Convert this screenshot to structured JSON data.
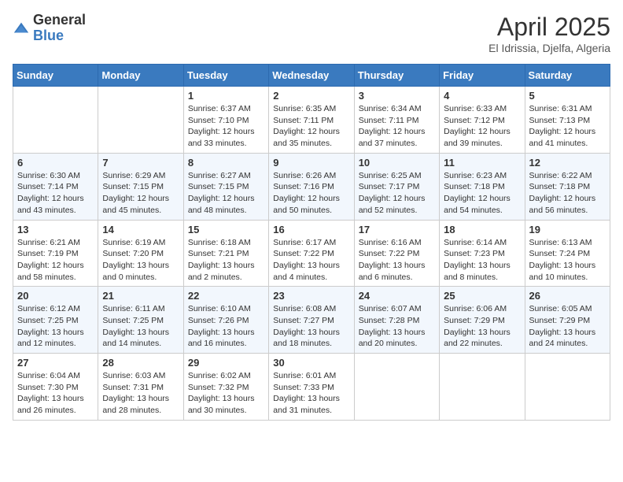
{
  "header": {
    "logo_general": "General",
    "logo_blue": "Blue",
    "title": "April 2025",
    "subtitle": "El Idrissia, Djelfa, Algeria"
  },
  "days_of_week": [
    "Sunday",
    "Monday",
    "Tuesday",
    "Wednesday",
    "Thursday",
    "Friday",
    "Saturday"
  ],
  "weeks": [
    [
      {
        "day": "",
        "info": ""
      },
      {
        "day": "",
        "info": ""
      },
      {
        "day": "1",
        "info": "Sunrise: 6:37 AM\nSunset: 7:10 PM\nDaylight: 12 hours and 33 minutes."
      },
      {
        "day": "2",
        "info": "Sunrise: 6:35 AM\nSunset: 7:11 PM\nDaylight: 12 hours and 35 minutes."
      },
      {
        "day": "3",
        "info": "Sunrise: 6:34 AM\nSunset: 7:11 PM\nDaylight: 12 hours and 37 minutes."
      },
      {
        "day": "4",
        "info": "Sunrise: 6:33 AM\nSunset: 7:12 PM\nDaylight: 12 hours and 39 minutes."
      },
      {
        "day": "5",
        "info": "Sunrise: 6:31 AM\nSunset: 7:13 PM\nDaylight: 12 hours and 41 minutes."
      }
    ],
    [
      {
        "day": "6",
        "info": "Sunrise: 6:30 AM\nSunset: 7:14 PM\nDaylight: 12 hours and 43 minutes."
      },
      {
        "day": "7",
        "info": "Sunrise: 6:29 AM\nSunset: 7:15 PM\nDaylight: 12 hours and 45 minutes."
      },
      {
        "day": "8",
        "info": "Sunrise: 6:27 AM\nSunset: 7:15 PM\nDaylight: 12 hours and 48 minutes."
      },
      {
        "day": "9",
        "info": "Sunrise: 6:26 AM\nSunset: 7:16 PM\nDaylight: 12 hours and 50 minutes."
      },
      {
        "day": "10",
        "info": "Sunrise: 6:25 AM\nSunset: 7:17 PM\nDaylight: 12 hours and 52 minutes."
      },
      {
        "day": "11",
        "info": "Sunrise: 6:23 AM\nSunset: 7:18 PM\nDaylight: 12 hours and 54 minutes."
      },
      {
        "day": "12",
        "info": "Sunrise: 6:22 AM\nSunset: 7:18 PM\nDaylight: 12 hours and 56 minutes."
      }
    ],
    [
      {
        "day": "13",
        "info": "Sunrise: 6:21 AM\nSunset: 7:19 PM\nDaylight: 12 hours and 58 minutes."
      },
      {
        "day": "14",
        "info": "Sunrise: 6:19 AM\nSunset: 7:20 PM\nDaylight: 13 hours and 0 minutes."
      },
      {
        "day": "15",
        "info": "Sunrise: 6:18 AM\nSunset: 7:21 PM\nDaylight: 13 hours and 2 minutes."
      },
      {
        "day": "16",
        "info": "Sunrise: 6:17 AM\nSunset: 7:22 PM\nDaylight: 13 hours and 4 minutes."
      },
      {
        "day": "17",
        "info": "Sunrise: 6:16 AM\nSunset: 7:22 PM\nDaylight: 13 hours and 6 minutes."
      },
      {
        "day": "18",
        "info": "Sunrise: 6:14 AM\nSunset: 7:23 PM\nDaylight: 13 hours and 8 minutes."
      },
      {
        "day": "19",
        "info": "Sunrise: 6:13 AM\nSunset: 7:24 PM\nDaylight: 13 hours and 10 minutes."
      }
    ],
    [
      {
        "day": "20",
        "info": "Sunrise: 6:12 AM\nSunset: 7:25 PM\nDaylight: 13 hours and 12 minutes."
      },
      {
        "day": "21",
        "info": "Sunrise: 6:11 AM\nSunset: 7:25 PM\nDaylight: 13 hours and 14 minutes."
      },
      {
        "day": "22",
        "info": "Sunrise: 6:10 AM\nSunset: 7:26 PM\nDaylight: 13 hours and 16 minutes."
      },
      {
        "day": "23",
        "info": "Sunrise: 6:08 AM\nSunset: 7:27 PM\nDaylight: 13 hours and 18 minutes."
      },
      {
        "day": "24",
        "info": "Sunrise: 6:07 AM\nSunset: 7:28 PM\nDaylight: 13 hours and 20 minutes."
      },
      {
        "day": "25",
        "info": "Sunrise: 6:06 AM\nSunset: 7:29 PM\nDaylight: 13 hours and 22 minutes."
      },
      {
        "day": "26",
        "info": "Sunrise: 6:05 AM\nSunset: 7:29 PM\nDaylight: 13 hours and 24 minutes."
      }
    ],
    [
      {
        "day": "27",
        "info": "Sunrise: 6:04 AM\nSunset: 7:30 PM\nDaylight: 13 hours and 26 minutes."
      },
      {
        "day": "28",
        "info": "Sunrise: 6:03 AM\nSunset: 7:31 PM\nDaylight: 13 hours and 28 minutes."
      },
      {
        "day": "29",
        "info": "Sunrise: 6:02 AM\nSunset: 7:32 PM\nDaylight: 13 hours and 30 minutes."
      },
      {
        "day": "30",
        "info": "Sunrise: 6:01 AM\nSunset: 7:33 PM\nDaylight: 13 hours and 31 minutes."
      },
      {
        "day": "",
        "info": ""
      },
      {
        "day": "",
        "info": ""
      },
      {
        "day": "",
        "info": ""
      }
    ]
  ]
}
